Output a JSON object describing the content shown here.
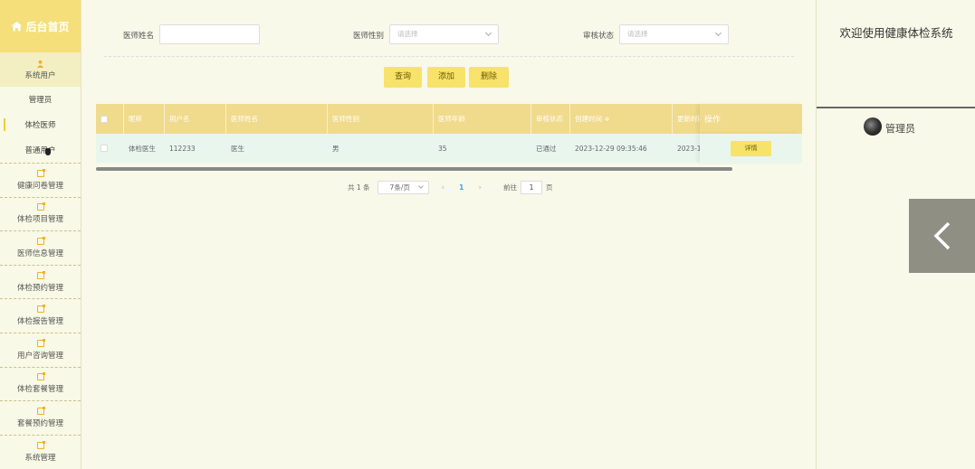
{
  "colors": {
    "accent": "#f7e36a",
    "header": "#f0da8c",
    "row": "#e8f6ee",
    "page_link": "#409eff"
  },
  "sidebar": {
    "home_label": "后台首页",
    "system_users": "系统用户",
    "sub_items": [
      {
        "label": "管理员"
      },
      {
        "label": "体检医师"
      },
      {
        "label": "普通用户"
      }
    ],
    "menus": [
      {
        "label": "健康问卷管理"
      },
      {
        "label": "体检项目管理"
      },
      {
        "label": "医师信息管理"
      },
      {
        "label": "体检预约管理"
      },
      {
        "label": "体检报告管理"
      },
      {
        "label": "用户咨询管理"
      },
      {
        "label": "体检套餐管理"
      },
      {
        "label": "套餐预约管理"
      },
      {
        "label": "系统管理"
      }
    ]
  },
  "search": {
    "name_label": "医师姓名",
    "name_value": "",
    "gender_label": "医师性别",
    "gender_placeholder": "请选择",
    "status_label": "审核状态",
    "status_placeholder": "请选择"
  },
  "buttons": {
    "query": "查询",
    "add": "添加",
    "delete": "删除"
  },
  "table": {
    "headers": [
      "昵称",
      "用户名",
      "医师姓名",
      "医师性别",
      "医师年龄",
      "审核状态",
      "创建时间 ≑",
      "更新时间"
    ],
    "op_header": "操作",
    "rows": [
      {
        "cells": [
          "体检医生",
          "112233",
          "医生",
          "男",
          "35",
          "已通过",
          "2023-12-29 09:35:46",
          "2023-1"
        ],
        "action": "详情"
      }
    ]
  },
  "pagination": {
    "total": "共 1 条",
    "page_size": "7条/页",
    "current_page": "1",
    "goto_label": "前往",
    "goto_value": "1",
    "goto_suffix": "页"
  },
  "right_panel": {
    "welcome": "欢迎使用健康体检系统",
    "username": "管理员"
  }
}
